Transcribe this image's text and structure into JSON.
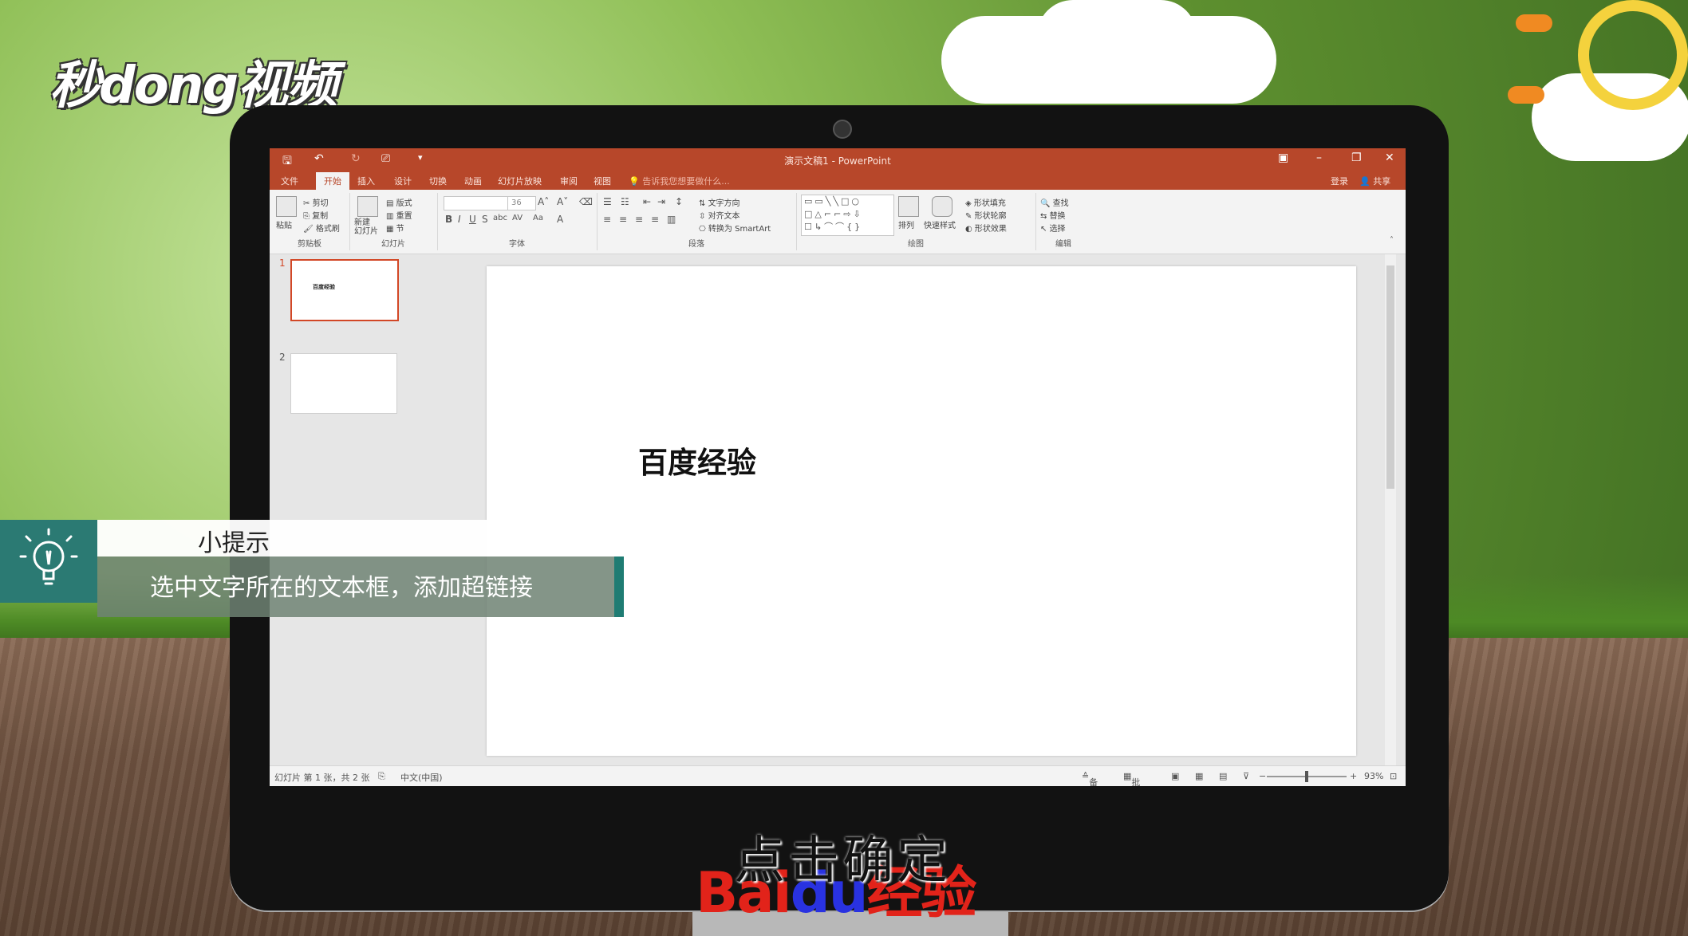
{
  "brand": {
    "logo_text": "秒dong视频"
  },
  "window": {
    "title": "演示文稿1 - PowerPoint",
    "signin": "登录",
    "share": "共享"
  },
  "tabs": [
    {
      "label": "文件"
    },
    {
      "label": "开始"
    },
    {
      "label": "插入"
    },
    {
      "label": "设计"
    },
    {
      "label": "切换"
    },
    {
      "label": "动画"
    },
    {
      "label": "幻灯片放映"
    },
    {
      "label": "审阅"
    },
    {
      "label": "视图"
    }
  ],
  "tell_me": "告诉我您想要做什么...",
  "ribbon": {
    "clipboard": {
      "label": "剪贴板",
      "paste": "粘贴",
      "cut": "剪切",
      "copy": "复制",
      "format_painter": "格式刷"
    },
    "slides": {
      "label": "幻灯片",
      "new_slide": "新建\n幻灯片",
      "layout": "版式",
      "reset": "重置",
      "section": "节"
    },
    "font": {
      "label": "字体",
      "size": "36"
    },
    "paragraph": {
      "label": "段落",
      "text_direction": "文字方向",
      "align_text": "对齐文本",
      "smartart": "转换为 SmartArt"
    },
    "drawing": {
      "label": "绘图",
      "arrange": "排列",
      "quick_styles": "快速样式",
      "shape_fill": "形状填充",
      "shape_outline": "形状轮廓",
      "shape_effects": "形状效果"
    },
    "editing": {
      "label": "编辑",
      "find": "查找",
      "replace": "替换",
      "select": "选择"
    }
  },
  "slides": [
    {
      "number": "1",
      "text": "百度经验"
    },
    {
      "number": "2",
      "text": ""
    }
  ],
  "current_slide_text": "百度经验",
  "status": {
    "slide_info": "幻灯片 第 1 张，共 2 张",
    "language": "中文(中国)",
    "notes": "备注",
    "comments": "批注",
    "zoom": "93%"
  },
  "tip": {
    "title": "小提示",
    "body": "选中文字所在的文本框，添加超链接"
  },
  "subtitle": "点击确定",
  "watermark": {
    "bai": "Bai",
    "du": "du",
    "jingyan": "经验"
  }
}
